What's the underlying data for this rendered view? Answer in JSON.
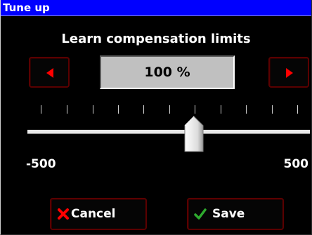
{
  "window": {
    "title": "Tune up"
  },
  "dialog": {
    "heading": "Learn compensation limits",
    "value_display": "100 %",
    "range_min": "-500",
    "range_max": "500",
    "slider_value": 100
  },
  "buttons": {
    "decrease_icon": "arrow-left-icon",
    "increase_icon": "arrow-right-icon",
    "cancel_label": "Cancel",
    "cancel_icon": "x-icon",
    "save_label": "Save",
    "save_icon": "checkmark-icon"
  },
  "colors": {
    "titlebar": "#0000ff",
    "background": "#000000",
    "accent_red": "#ff0000",
    "button_border": "#5a0000",
    "save_check": "#2eaa2e"
  }
}
